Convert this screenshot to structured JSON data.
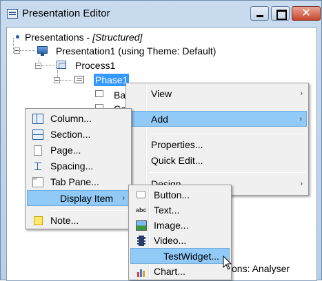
{
  "window": {
    "title": "Presentation Editor",
    "close_glyph": "✕"
  },
  "tree": {
    "root": {
      "label": "Presentations - ",
      "suffix": "[Structured]"
    },
    "presentation": {
      "label": "Presentation1 (using Theme: Default)"
    },
    "process": {
      "label": "Process1"
    },
    "phase": {
      "label": "Phase1"
    },
    "child1": {
      "label": "Bac"
    },
    "child2": {
      "label": "Cor"
    },
    "child_bottom": {
      "label": "ons: Analyser"
    }
  },
  "context_menu": {
    "items": [
      {
        "label": "View",
        "has_submenu": true
      },
      {
        "label": "Add",
        "has_submenu": true,
        "highlighted": true
      },
      {
        "label": "Properties..."
      },
      {
        "label": "Quick Edit..."
      },
      {
        "label": "Design",
        "has_submenu": true
      }
    ],
    "arrow": "›"
  },
  "add_menu": {
    "items": [
      {
        "label": "Column...",
        "icon": "column-icon"
      },
      {
        "label": "Section...",
        "icon": "section-icon"
      },
      {
        "label": "Page...",
        "icon": "page-icon"
      },
      {
        "label": "Spacing...",
        "icon": "spacing-icon"
      },
      {
        "label": "Tab Pane...",
        "icon": "tab-pane-icon"
      },
      {
        "label": "Display Item",
        "icon": "",
        "has_submenu": true,
        "highlighted": true
      },
      {
        "label": "Note...",
        "icon": "note-icon"
      }
    ],
    "arrow": "›"
  },
  "display_menu": {
    "items": [
      {
        "label": "Button...",
        "icon": "button-icon"
      },
      {
        "label": "Text...",
        "icon": "text-icon",
        "icon_text": "abc"
      },
      {
        "label": "Image...",
        "icon": "image-icon"
      },
      {
        "label": "Video...",
        "icon": "video-icon"
      },
      {
        "label": "TestWidget...",
        "icon": "",
        "highlighted": true
      },
      {
        "label": "Chart...",
        "icon": "chart-icon"
      }
    ]
  },
  "colors": {
    "highlight": "#91c9f7",
    "selection": "#3399ff",
    "titlebar": "#c9dbee",
    "close": "#c7452b"
  }
}
